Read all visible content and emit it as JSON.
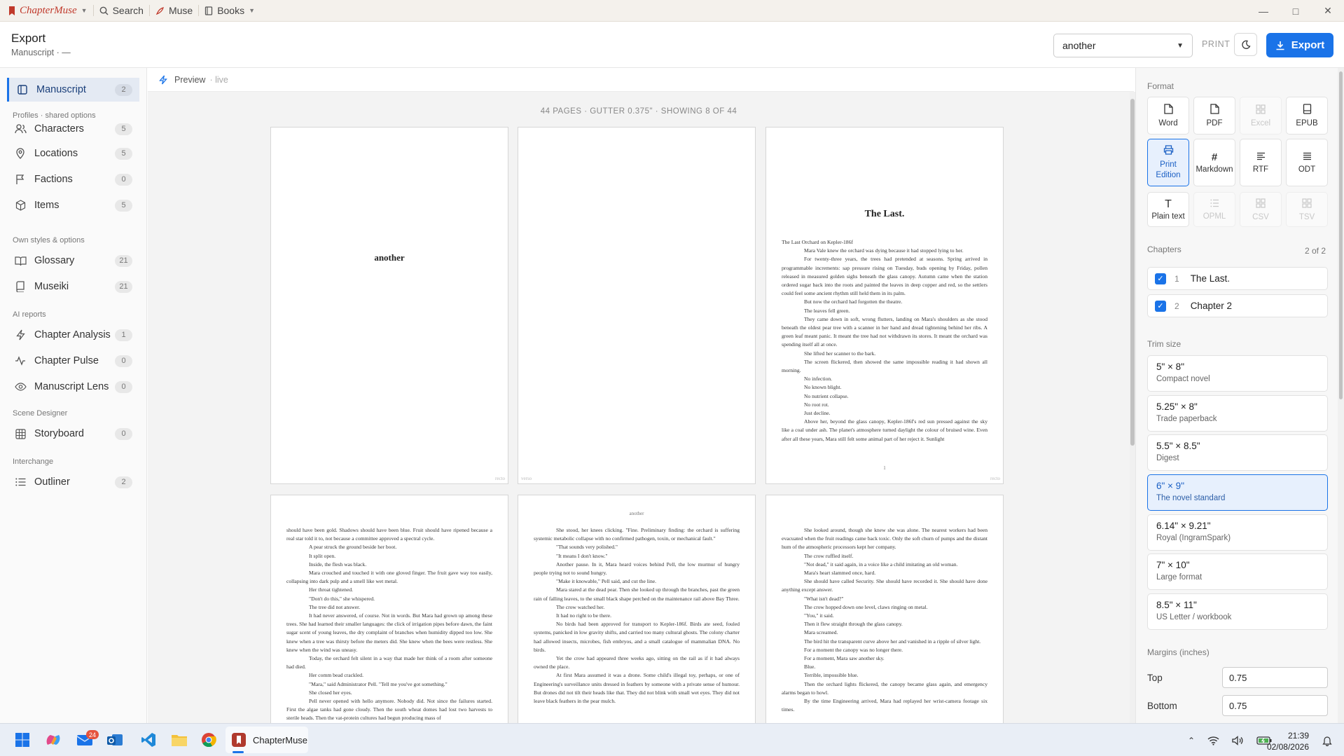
{
  "titlebar": {
    "brand": "ChapterMuse",
    "menu": [
      {
        "label": "Search",
        "icon": "search-icon"
      },
      {
        "label": "Muse",
        "icon": "feather-icon"
      },
      {
        "label": "Books",
        "icon": "book-icon"
      }
    ]
  },
  "header": {
    "title": "Export",
    "subtitle": "Manuscript · —",
    "document_select": "another",
    "print_label": "PRINT",
    "export_label": "Export"
  },
  "sidebar": {
    "items": [
      {
        "label": "Manuscript",
        "count": "2",
        "icon": "manuscript-icon",
        "active": true
      },
      {
        "label": "Characters",
        "count": "5",
        "icon": "people-icon"
      },
      {
        "label": "Locations",
        "count": "5",
        "icon": "pin-icon"
      },
      {
        "label": "Factions",
        "count": "0",
        "icon": "flag-icon"
      },
      {
        "label": "Items",
        "count": "5",
        "icon": "cube-icon"
      },
      {
        "label": "Glossary",
        "count": "21",
        "icon": "open-book-icon"
      },
      {
        "label": "Museiki",
        "count": "21",
        "icon": "book-icon"
      },
      {
        "label": "Chapter Analysis",
        "count": "1",
        "icon": "bolt-icon"
      },
      {
        "label": "Chapter Pulse",
        "count": "0",
        "icon": "pulse-icon"
      },
      {
        "label": "Manuscript Lens",
        "count": "0",
        "icon": "eye-icon"
      },
      {
        "label": "Storyboard",
        "count": "0",
        "icon": "grid-icon"
      },
      {
        "label": "Outliner",
        "count": "2",
        "icon": "list-icon"
      }
    ],
    "sections": [
      "Profiles · shared options",
      "Own styles & options",
      "AI reports",
      "Scene Designer",
      "Interchange"
    ]
  },
  "preview": {
    "label": "Preview",
    "status": "· live",
    "info": "44 PAGES · GUTTER 0.375\" · SHOWING 8 OF 44",
    "pages": {
      "p1_title": "another",
      "p1_foot": "recto",
      "p2_foot": "verso",
      "p3_title": "The Last.",
      "p3_num": "1",
      "p3_foot": "recto",
      "p5_head": "another",
      "p3_text": [
        "The Last Orchard on Kepler-186f",
        "Mara Vale knew the orchard was dying because it had stopped lying to her.",
        "For twenty-three years, the trees had pretended at seasons. Spring arrived in programmable increments: sap pressure rising on Tuesday, buds opening by Friday, pollen released in measured golden sighs beneath the glass canopy. Autumn came when the station ordered sugar back into the roots and painted the leaves in deep copper and red, so the settlers could feel some ancient rhythm still held them in its palm.",
        "But now the orchard had forgotten the theatre.",
        "The leaves fell green.",
        "They came down in soft, wrong flutters, landing on Mara's shoulders as she stood beneath the oldest pear tree with a scanner in her hand and dread tightening behind her ribs. A green leaf meant panic. It meant the tree had not withdrawn its stores. It meant the orchard was spending itself all at once.",
        "She lifted her scanner to the bark.",
        "The screen flickered, then showed the same impossible reading it had shown all morning.",
        "No infection.",
        "No known blight.",
        "No nutrient collapse.",
        "No root rot.",
        "Just decline.",
        "Above her, beyond the glass canopy, Kepler-186f's red sun pressed against the sky like a coal under ash. The planet's atmosphere turned daylight the colour of bruised wine. Even after all these years, Mara still felt some animal part of her reject it. Sunlight"
      ],
      "p4_text": [
        "should have been gold. Shadows should have been blue. Fruit should have ripened because a real star told it to, not because a committee approved a spectral cycle.",
        "A pear struck the ground beside her boot.",
        "It split open.",
        "Inside, the flesh was black.",
        "Mara crouched and touched it with one gloved finger. The fruit gave way too easily, collapsing into dark pulp and a smell like wet metal.",
        "Her throat tightened.",
        "\"Don't do this,\" she whispered.",
        "The tree did not answer.",
        "It had never answered, of course. Not in words. But Mara had grown up among these trees. She had learned their smaller languages: the click of irrigation pipes before dawn, the faint sugar scent of young leaves, the dry complaint of branches when humidity dipped too low. She knew when a tree was thirsty before the meters did. She knew when the bees were restless. She knew when the wind was uneasy.",
        "Today, the orchard felt silent in a way that made her think of a room after someone had died.",
        "Her comm bead crackled.",
        "\"Mara,\" said Administrator Pell. \"Tell me you've got something.\"",
        "She closed her eyes.",
        "Pell never opened with hello anymore. Nobody did. Not since the failures started. First the algae tanks had gone cloudy. Then the south wheat domes had lost two harvests to sterile heads. Then the vat-protein cultures had begun producing mass of"
      ],
      "p5_text": [
        "She stood, her knees clicking. \"Fine. Preliminary finding: the orchard is suffering systemic metabolic collapse with no confirmed pathogen, toxin, or mechanical fault.\"",
        "\"That sounds very polished.\"",
        "\"It means I don't know.\"",
        "Another pause. In it, Mara heard voices behind Pell, the low murmur of hungry people trying not to sound hungry.",
        "\"Make it knowable,\" Pell said, and cut the line.",
        "Mara stared at the dead pear. Then she looked up through the branches, past the green rain of falling leaves, to the small black shape perched on the maintenance rail above Bay Three.",
        "The crow watched her.",
        "It had no right to be there.",
        "No birds had been approved for transport to Kepler-186f. Birds ate seed, fouled systems, panicked in low gravity shifts, and carried too many cultural ghosts. The colony charter had allowed insects, microbes, fish embryos, and a small catalogue of mammalian DNA. No birds.",
        "Yet the crow had appeared three weeks ago, sitting on the rail as if it had always owned the place.",
        "At first Mara assumed it was a drone. Some child's illegal toy, perhaps, or one of Engineering's surveillance units dressed in feathers by someone with a private sense of humour. But drones did not tilt their heads like that. They did not blink with small wet eyes. They did not leave black feathers in the pear mulch."
      ],
      "p6_text": [
        "She looked around, though she knew she was alone. The nearest workers had been evacuated when the fruit readings came back toxic. Only the soft churn of pumps and the distant hum of the atmospheric processors kept her company.",
        "The crow ruffled itself.",
        "\"Not dead,\" it said again, in a voice like a child imitating an old woman.",
        "Mara's heart slammed once, hard.",
        "She should have called Security. She should have recorded it. She should have done anything except answer.",
        "\"What isn't dead?\"",
        "The crow hopped down one level, claws ringing on metal.",
        "\"You,\" it said.",
        "Then it flew straight through the glass canopy.",
        "Mara screamed.",
        "The bird hit the transparent curve above her and vanished in a ripple of silver light.",
        "For a moment the canopy was no longer there.",
        "For a moment, Mara saw another sky.",
        "Blue.",
        "Terrible, impossible blue.",
        "Then the orchard lights flickered, the canopy became glass again, and emergency alarms began to howl.",
        "By the time Engineering arrived, Mara had replayed her wrist-camera footage six times."
      ]
    }
  },
  "right_panel": {
    "format_label": "Format",
    "formats": [
      {
        "label": "Word",
        "icon": "word-doc-icon",
        "state": "normal"
      },
      {
        "label": "PDF",
        "icon": "pdf-doc-icon",
        "state": "normal"
      },
      {
        "label": "Excel",
        "icon": "excel-grid-icon",
        "state": "disabled"
      },
      {
        "label": "EPUB",
        "icon": "epub-book-icon",
        "state": "normal"
      },
      {
        "label": "Print Edition",
        "icon": "printer-icon",
        "state": "selected"
      },
      {
        "label": "Markdown",
        "icon": "hash-icon",
        "state": "normal"
      },
      {
        "label": "RTF",
        "icon": "align-left-icon",
        "state": "normal"
      },
      {
        "label": "ODT",
        "icon": "align-justify-icon",
        "state": "normal"
      },
      {
        "label": "Plain text",
        "icon": "text-t-icon",
        "state": "normal"
      },
      {
        "label": "OPML",
        "icon": "outline-list-icon",
        "state": "disabled"
      },
      {
        "label": "CSV",
        "icon": "csv-grid-icon",
        "state": "disabled"
      },
      {
        "label": "TSV",
        "icon": "tsv-grid-icon",
        "state": "disabled"
      }
    ],
    "chapters_label": "Chapters",
    "chapters_count": "2 of 2",
    "chapters": [
      {
        "num": "1",
        "title": "The Last."
      },
      {
        "num": "2",
        "title": "Chapter 2"
      }
    ],
    "trim_label": "Trim size",
    "trims": [
      {
        "size": "5\" × 8\"",
        "desc": "Compact novel"
      },
      {
        "size": "5.25\" × 8\"",
        "desc": "Trade paperback"
      },
      {
        "size": "5.5\" × 8.5\"",
        "desc": "Digest"
      },
      {
        "size": "6\" × 9\"",
        "desc": "The novel standard",
        "selected": true
      },
      {
        "size": "6.14\" × 9.21\"",
        "desc": "Royal (IngramSpark)"
      },
      {
        "size": "7\" × 10\"",
        "desc": "Large format"
      },
      {
        "size": "8.5\" × 11\"",
        "desc": "US Letter / workbook"
      }
    ],
    "margins_label": "Margins (inches)",
    "margins": {
      "top_label": "Top",
      "top": "0.75",
      "bottom_label": "Bottom",
      "bottom": "0.75"
    }
  },
  "taskbar": {
    "app_label": "ChapterMuse",
    "mail_badge": "24",
    "time": "21:39",
    "date": "02/08/2026"
  },
  "colors": {
    "accent": "#1a73e8",
    "brand": "#c0392b"
  }
}
